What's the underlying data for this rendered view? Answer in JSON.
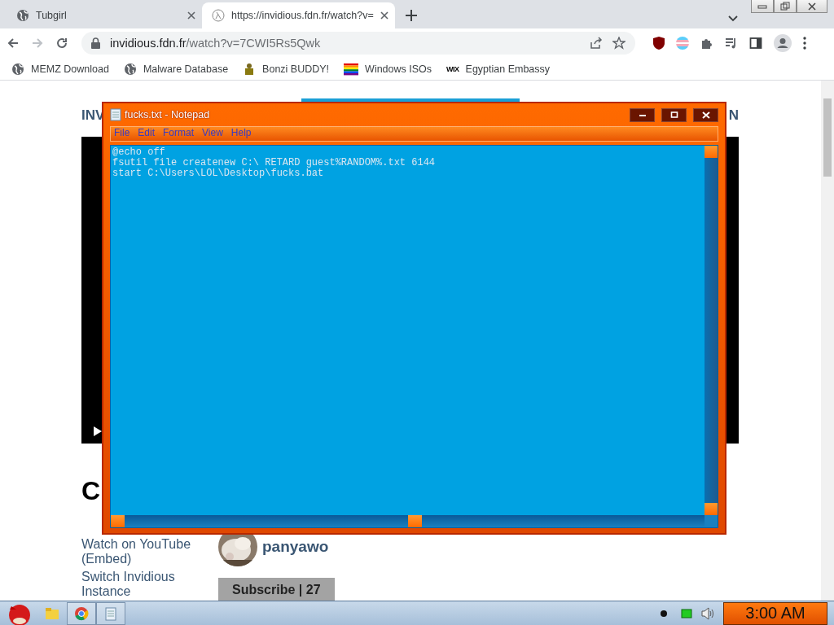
{
  "browser": {
    "tabs": [
      {
        "title": "Tubgirl",
        "selected": false
      },
      {
        "title": "https://invidious.fdn.fr/watch?v=",
        "selected": true
      }
    ],
    "nav": [
      {
        "kind": "back",
        "disabled": false
      },
      {
        "kind": "forward",
        "disabled": true
      },
      {
        "kind": "reload",
        "disabled": false
      }
    ],
    "address": {
      "host": "invidious.fdn.fr",
      "path": "/watch?v=7CWI5Rs5Qwk"
    },
    "bookmarks": [
      {
        "label": "MEMZ Download"
      },
      {
        "label": "Malware Database"
      },
      {
        "label": "Bonzi BUDDY!"
      },
      {
        "label": "Windows ISOs"
      },
      {
        "label": "Egyptian Embassy",
        "icon_text": "WIX"
      }
    ]
  },
  "page": {
    "header_left": "INV",
    "header_right": "N",
    "heading": "C",
    "links": [
      "Watch on YouTube",
      "(Embed)",
      "Switch Invidious Instance"
    ],
    "channel": "panyawo",
    "subscribe": "Subscribe | 27"
  },
  "notepad": {
    "title": "fucks.txt - Notepad",
    "menu": [
      "File",
      "Edit",
      "Format",
      "View",
      "Help"
    ],
    "lines": [
      "@echo off",
      "fsutil file createnew C:\\ RETARD guest%RANDOM%.txt 6144",
      "start C:\\Users\\LOL\\Desktop\\fucks.bat"
    ]
  },
  "taskbar": {
    "clock": "3:00 AM"
  }
}
